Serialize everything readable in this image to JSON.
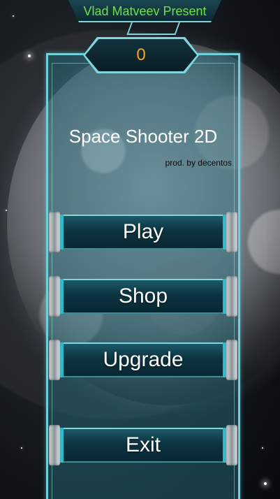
{
  "header": {
    "banner_text": "Vlad Matveev Present"
  },
  "score": {
    "value": "0"
  },
  "title": {
    "game_name": "Space Shooter 2D",
    "credit": "prod. by decentos"
  },
  "menu": {
    "items": [
      {
        "label": "Play"
      },
      {
        "label": "Shop"
      },
      {
        "label": "Upgrade"
      },
      {
        "label": "Exit"
      }
    ]
  },
  "colors": {
    "banner_text": "#6fe04a",
    "score_text": "#f5a623",
    "panel_border": "#6fd0d8",
    "button_face": "#0c3340"
  }
}
